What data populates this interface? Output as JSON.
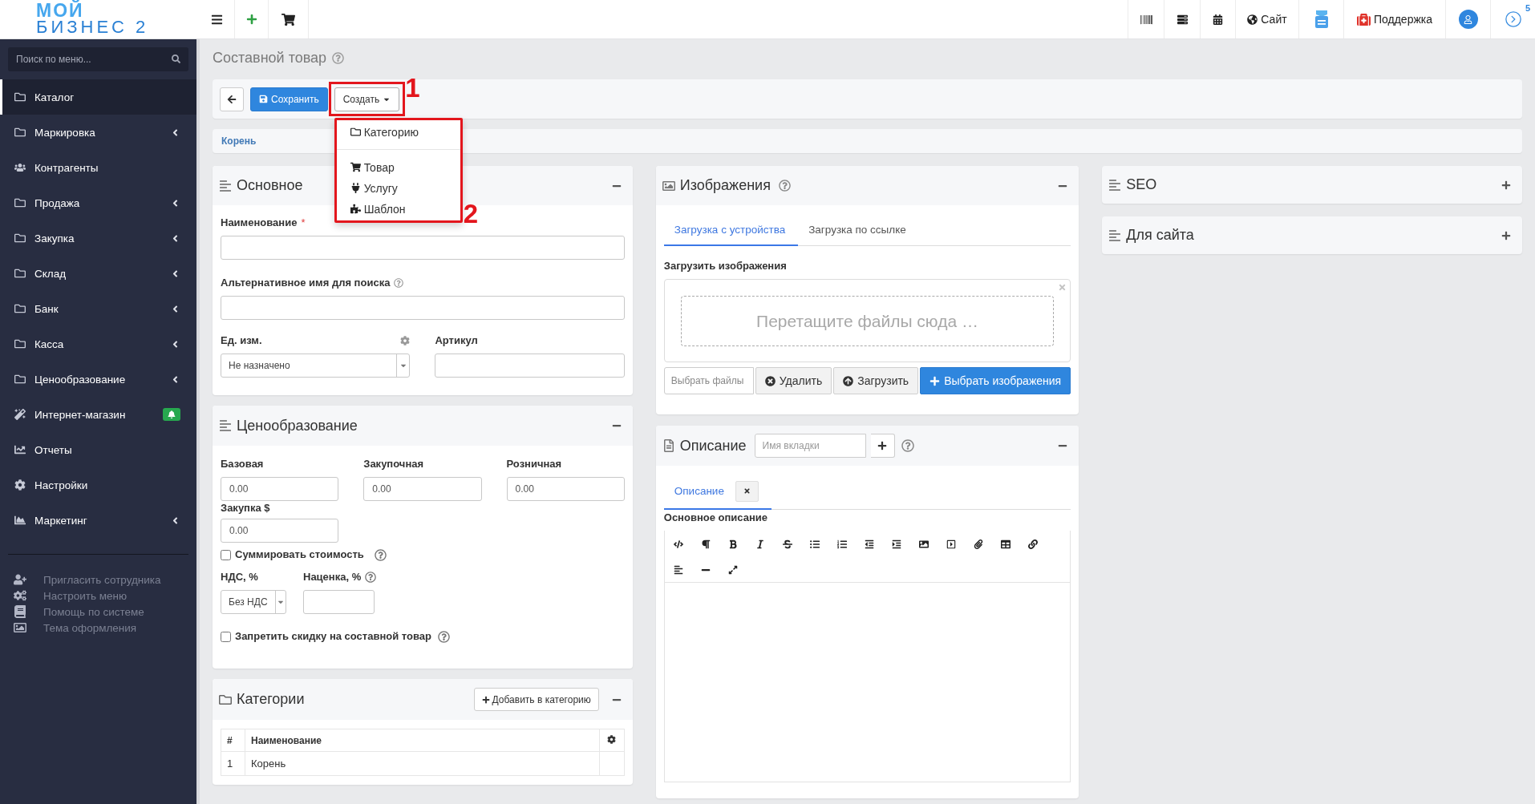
{
  "logo": {
    "top": "МОЙ",
    "bottom": "БИЗНЕС 2"
  },
  "header": {
    "site": "Сайт",
    "support": "Поддержка",
    "badge": "5"
  },
  "sidebar": {
    "search": {
      "placeholder": "Поиск по меню..."
    },
    "items": [
      {
        "label": "Каталог",
        "kind": "folder",
        "selected": true,
        "has_submenu": false,
        "alert": false
      },
      {
        "label": "Маркировка",
        "kind": "folder",
        "selected": false,
        "has_submenu": true,
        "alert": false
      },
      {
        "label": "Контрагенты",
        "kind": "users",
        "selected": false,
        "has_submenu": false,
        "alert": false
      },
      {
        "label": "Продажа",
        "kind": "folder",
        "selected": false,
        "has_submenu": true,
        "alert": false
      },
      {
        "label": "Закупка",
        "kind": "folder",
        "selected": false,
        "has_submenu": true,
        "alert": false
      },
      {
        "label": "Склад",
        "kind": "folder",
        "selected": false,
        "has_submenu": true,
        "alert": false
      },
      {
        "label": "Банк",
        "kind": "folder",
        "selected": false,
        "has_submenu": true,
        "alert": false
      },
      {
        "label": "Касса",
        "kind": "folder",
        "selected": false,
        "has_submenu": true,
        "alert": false
      },
      {
        "label": "Ценообразование",
        "kind": "folder",
        "selected": false,
        "has_submenu": true,
        "alert": false
      },
      {
        "label": "Интернет-магазин",
        "kind": "wand",
        "selected": false,
        "has_submenu": false,
        "alert": true
      },
      {
        "label": "Отчеты",
        "kind": "chart",
        "selected": false,
        "has_submenu": false,
        "alert": false
      },
      {
        "label": "Настройки",
        "kind": "gear",
        "selected": false,
        "has_submenu": false,
        "alert": false
      },
      {
        "label": "Маркетинг",
        "kind": "area",
        "selected": false,
        "has_submenu": true,
        "alert": false
      }
    ],
    "footer_links": [
      {
        "label": "Пригласить сотрудника",
        "kind": "invite"
      },
      {
        "label": "Настроить меню",
        "kind": "menu_settings"
      },
      {
        "label": "Помощь по системе",
        "kind": "help"
      },
      {
        "label": "Тема оформления",
        "kind": "theme"
      }
    ]
  },
  "page": {
    "title": "Составной товар"
  },
  "toolbar": {
    "save": "Сохранить",
    "create": "Создать",
    "create_menu": {
      "open": true,
      "items": [
        {
          "kind": "category",
          "label": "Категорию"
        },
        {
          "kind": "divider"
        },
        {
          "kind": "product",
          "label": "Товар"
        },
        {
          "kind": "service",
          "label": "Услугу"
        },
        {
          "kind": "template",
          "label": "Шаблон"
        }
      ]
    }
  },
  "annotations": {
    "create_button": "1",
    "create_menu": "2"
  },
  "breadcrumb": [
    "Корень"
  ],
  "basic": {
    "title": "Основное",
    "expanded": true,
    "name_label": "Наименование",
    "required_mark": "*",
    "alt_name_label": "Альтернативное имя для поиска",
    "unit_label": "Ед. изм.",
    "unit_value": "Не назначено",
    "article_label": "Артикул"
  },
  "pricing": {
    "title": "Ценообразование",
    "expanded": true,
    "prices": [
      {
        "label": "Базовая",
        "value": "0.00"
      },
      {
        "label": "Закупочная",
        "value": "0.00"
      },
      {
        "label": "Розничная",
        "value": "0.00"
      }
    ],
    "purchase_usd": {
      "label": "Закупка $",
      "value": "0.00"
    },
    "sum_cost": {
      "label": "Суммировать стоимость",
      "checked": false
    },
    "vat": {
      "label": "НДС, %",
      "value": "Без НДС"
    },
    "markup": {
      "label": "Наценка, %"
    },
    "forbid_discount": {
      "label": "Запретить скидку на составной товар",
      "checked": false
    }
  },
  "categories": {
    "title": "Категории",
    "expanded": true,
    "add_button": "Добавить в категорию",
    "columns": [
      "#",
      "Наименование"
    ],
    "rows": [
      {
        "cells": [
          "1",
          "Корень"
        ]
      }
    ]
  },
  "images": {
    "title": "Изображения",
    "expanded": true,
    "tabs": [
      {
        "label": "Загрузка с устройства",
        "selected": true
      },
      {
        "label": "Загрузка по ссылке",
        "selected": false
      }
    ],
    "upload_label": "Загрузить изображения",
    "dropzone": "Перетащите файлы сюда …",
    "file_field": {
      "placeholder": "Выбрать файлы"
    },
    "buttons": [
      {
        "label": "Удалить",
        "kind": "remove"
      },
      {
        "label": "Загрузить",
        "kind": "upload"
      },
      {
        "label": "Выбрать изображения",
        "kind": "primary"
      }
    ]
  },
  "description": {
    "title": "Описание",
    "expanded": true,
    "tab_name_field": {
      "placeholder": "Имя вкладки"
    },
    "tabs": [
      {
        "label": "Описание",
        "selected": true
      }
    ],
    "editor_label": "Основное описание"
  },
  "side_panels": [
    {
      "title": "SEO",
      "expanded": false
    },
    {
      "title": "Для сайта",
      "expanded": false
    }
  ]
}
